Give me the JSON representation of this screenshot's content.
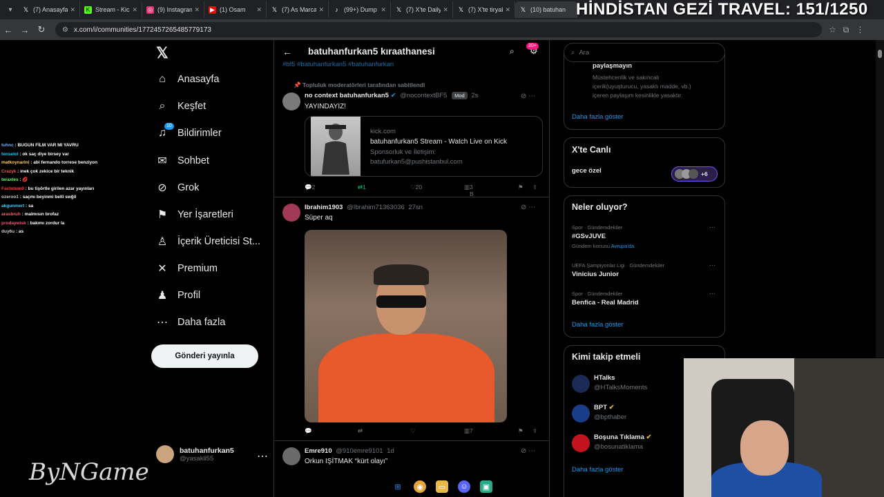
{
  "browser": {
    "tabs": [
      {
        "label": "(7) Anasayfa",
        "icon": "x-icon",
        "color": "#ffffff"
      },
      {
        "label": "Stream - Kick",
        "icon": "kick-icon",
        "color": "#53fc18"
      },
      {
        "label": "(9) Instagram",
        "icon": "instagram-icon",
        "color": "#e1306c"
      },
      {
        "label": "(1) Osam",
        "icon": "youtube-icon",
        "color": "#ff0000"
      },
      {
        "label": "(7) As Marca",
        "icon": "x-icon",
        "color": "#ffffff"
      },
      {
        "label": "(99+) Dump",
        "icon": "tiktok-icon",
        "color": "#ffffff"
      },
      {
        "label": "(7) X'te Daily",
        "icon": "x-icon",
        "color": "#ffffff"
      },
      {
        "label": "(7) X'te tiryaki",
        "icon": "x-icon",
        "color": "#ffffff"
      },
      {
        "label": "(10) batuhan",
        "icon": "x-icon",
        "color": "#ffffff",
        "active": true
      }
    ],
    "url": "x.com/i/communities/1772457265485779173"
  },
  "overlay": {
    "title": "HİNDİSTAN GEZİ TRAVEL: 151/1250"
  },
  "chat": [
    {
      "user": "tuhnc",
      "text": "BUGUN FİLM VAR MI YAVRU",
      "color": "#7bb0ff"
    },
    {
      "user": "tenselol",
      "text": "ok saç diye birsey var",
      "color": "#00d0ff"
    },
    {
      "user": "matkoynarini",
      "text": "abi fernando torrese benziyon",
      "color": "#ffd24d"
    },
    {
      "user": "Crazyk",
      "text": "inek çok zekice bir teknik",
      "color": "#ff5252"
    },
    {
      "user": "teraxles",
      "text": "💋",
      "color": "#62ff6a"
    },
    {
      "user": "Factotum9",
      "text": "bu tişörtle girilen azar yayınları",
      "color": "#ff3b3b"
    },
    {
      "user": "ozeroo1",
      "text": "saçmı beyinmi belli swğil",
      "color": "#cccccc"
    },
    {
      "user": "akgunmert",
      "text": "sa",
      "color": "#33d6ff"
    },
    {
      "user": "arasbruh",
      "text": "malmısın brofaz",
      "color": "#ff6060"
    },
    {
      "user": "prodaywisk",
      "text": "bakımı zordur la",
      "color": "#ff4f7a"
    },
    {
      "user": "duy6u",
      "text": "as",
      "color": "#cccccc"
    }
  ],
  "watermark": "ByNGame",
  "sidebar": {
    "logo": "X",
    "items": [
      {
        "label": "Anasayfa",
        "icon": "home-icon",
        "glyph": "⌂"
      },
      {
        "label": "Keşfet",
        "icon": "search-icon",
        "glyph": "⌕"
      },
      {
        "label": "Bildirimler",
        "icon": "bell-icon",
        "glyph": "🔔",
        "badge": "10"
      },
      {
        "label": "Sohbet",
        "icon": "mail-icon",
        "glyph": "✉"
      },
      {
        "label": "Grok",
        "icon": "grok-icon",
        "glyph": "⊘"
      },
      {
        "label": "Yer İşaretleri",
        "icon": "bookmark-icon",
        "glyph": "⚑"
      },
      {
        "label": "İçerik Üreticisi St...",
        "icon": "creator-icon",
        "glyph": "♙"
      },
      {
        "label": "Premium",
        "icon": "x-premium-icon",
        "glyph": "✕"
      },
      {
        "label": "Profil",
        "icon": "profile-icon",
        "glyph": "♟"
      },
      {
        "label": "Daha fazla",
        "icon": "more-circle-icon",
        "glyph": "⋯"
      }
    ],
    "post_button": "Gönderi yayınla",
    "account": {
      "name": "batuhanfurkan5",
      "handle": "@yasakli55"
    }
  },
  "feed": {
    "title": "batuhanfurkan5 kıraathanesi",
    "notif_badge": "20+",
    "hashtags": "#bf5   #batuhanfurkan5   #batuhanfurkan",
    "tweets": [
      {
        "pinned": "Topluluk moderatörleri tarafından sabitlendi",
        "name": "no context batuhanfurkan5",
        "handle": "@nocontextBF5",
        "badge": "Mod",
        "time": "2s",
        "text": "YAYINDAYIZ!",
        "card": {
          "domain": "kick.com",
          "title": "batuhanfurkan5 Stream - Watch Live on Kick",
          "desc1": "Sponsorluk ve İletişim:",
          "desc2": "batufurkan5@pushistanbul.com"
        },
        "replies": "2",
        "reposts": "1",
        "likes": "20",
        "views": "3 B"
      },
      {
        "name": "Ibrahim1903",
        "handle": "@Ibrahim71363036",
        "time": "27sn",
        "text": "Süper aq",
        "views": "7"
      },
      {
        "name": "Emre910",
        "handle": "@910emre9101",
        "time": "1d",
        "text": "Orkun IŞİTMAK “kürt olayı”"
      }
    ]
  },
  "right": {
    "search_placeholder": "Ara",
    "rules": {
      "title": "paylaşmayın",
      "text1": "Müstehcenlik ve sakıncalı",
      "text2": "içerik(uyuşturucu, yasaklı madde, vb.)",
      "text3": "içeren paylaşım kesinlikle yasaktır.",
      "more": "Daha fazla göster"
    },
    "live": {
      "title": "X'te Canlı",
      "space": "gece özel",
      "count": "+6"
    },
    "trends": {
      "title": "Neler oluyor?",
      "items": [
        {
          "cat": "Spor · Gündemdekiler",
          "name": "#GSvJUVE",
          "sub": "Gündem konusu",
          "sub_link": "Avrupa'da"
        },
        {
          "cat": "UEFA Şampiyonlar Ligi · Gündemdekiler",
          "name": "Vinicius Junior"
        },
        {
          "cat": "Spor · Gündemdekiler",
          "name": "Benfica - Real Madrid"
        }
      ],
      "more": "Daha fazla göster"
    },
    "who_to_follow": {
      "title": "Kimi takip etmeli",
      "items": [
        {
          "name": "HTalks",
          "handle": "@HTalksMoments",
          "color": "#1c2a56"
        },
        {
          "name": "BPT",
          "handle": "@bpthaber",
          "color": "#1a3d8a",
          "verified": true
        },
        {
          "name": "Boşuna Tıklama",
          "handle": "@bosunatiklama",
          "color": "#c3131c",
          "verified": true
        }
      ],
      "more": "Daha fazla göster"
    }
  }
}
